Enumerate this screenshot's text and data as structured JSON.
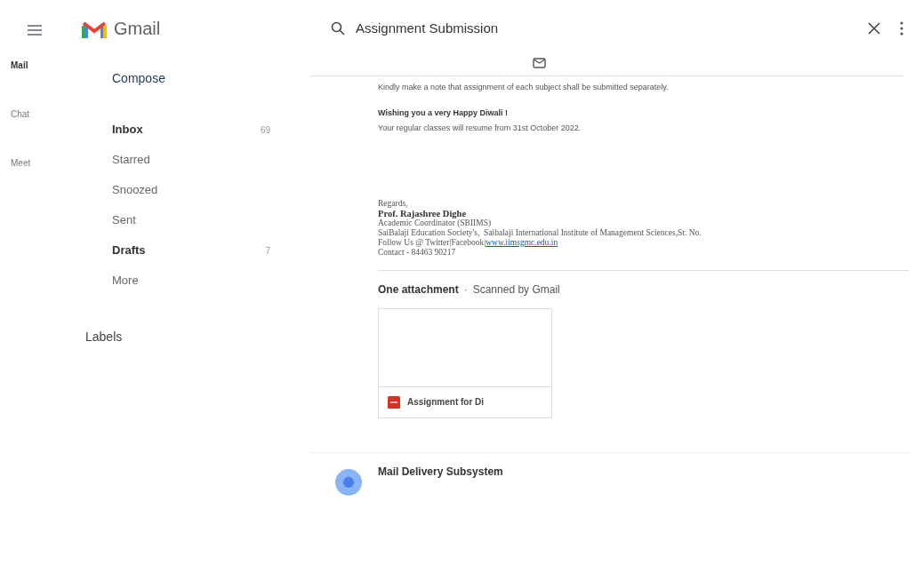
{
  "header": {
    "app_name": "Gmail",
    "search_value": "Assignment Submission"
  },
  "rail": [
    {
      "label": "Mail",
      "selected": true
    },
    {
      "label": "Chat",
      "selected": false
    },
    {
      "label": "Meet",
      "selected": false
    }
  ],
  "compose": "Compose",
  "folders": [
    {
      "label": "Inbox",
      "count": "69",
      "bold": true
    },
    {
      "label": "Starred",
      "bold": false
    },
    {
      "label": "Snoozed",
      "bold": false
    },
    {
      "label": "Sent",
      "bold": false
    },
    {
      "label": "Drafts",
      "count": "7",
      "bold": true
    },
    {
      "label": "More",
      "bold": false
    }
  ],
  "labels_heading": "Labels",
  "message": {
    "body": [
      "Kindly make a note that assignment of each subject shall be submitted separately."
    ],
    "greeting": "Wishing you a very Happy Diwali !",
    "note": "Your regular classes will resume from 31st October 2022.",
    "signature": {
      "closing": "Regards,",
      "name": "Prof. Rajashree Dighe",
      "role": "Academic Coordinator (SBIIMS)",
      "org": "SaiBalaji Education Society's,  Saibalaji International Institute of Management Sciences,Sr. No.",
      "follow": "Follow Us @ Twitter|Facebook|",
      "link": "www.iimsgmc.edu.in",
      "contact": "Contact - 84463 90217"
    },
    "attachments_heading": "One attachment",
    "separator": "·",
    "scan_note": "Scanned by Gmail",
    "attachments": [
      {
        "name": "Assignment for Di"
      }
    ]
  },
  "next_message": {
    "sender": "Mail Delivery Subsystem"
  }
}
